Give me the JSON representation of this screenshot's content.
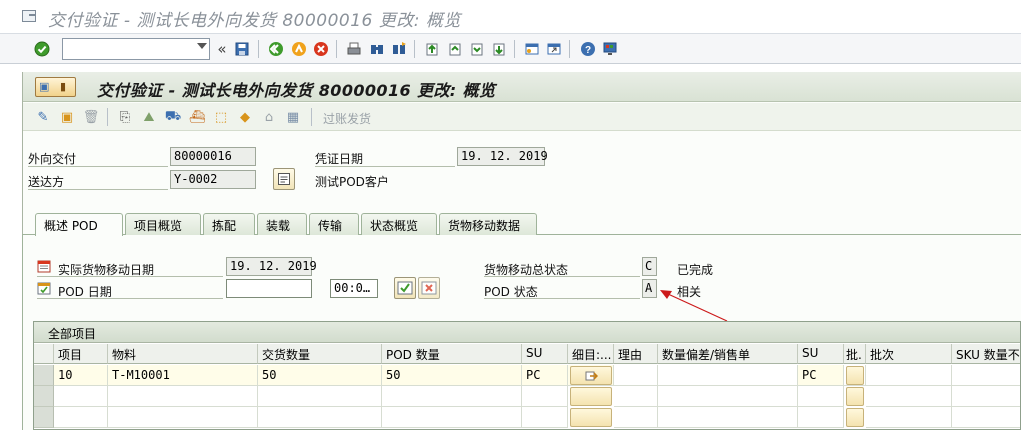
{
  "window": {
    "title": "交付验证 - 测试长电外向发货 80000016 更改: 概览"
  },
  "system_toolbar": {
    "command_field": "",
    "icons": [
      "enter-icon",
      "back-arrows-icon",
      "save-icon",
      "back-icon",
      "exit-icon",
      "cancel-icon",
      "print-icon",
      "find-icon",
      "find-next-icon",
      "first-page-icon",
      "prev-page-icon",
      "next-page-icon",
      "last-page-icon",
      "new-session-icon",
      "shortcut-icon",
      "help-icon",
      "customize-layout-icon"
    ]
  },
  "app": {
    "title": "交付验证 - 测试长电外向发货 80000016 更改: 概览",
    "toolbar": {
      "post_gi_label": "过账发货"
    },
    "header": {
      "outbound_delivery_label": "外向交付",
      "outbound_delivery_value": "80000016",
      "ship_to_label": "送达方",
      "ship_to_value": "Y-0002",
      "ship_to_name": "测试POD客户",
      "doc_date_label": "凭证日期",
      "doc_date_value": "19. 12. 2019"
    },
    "tabs": [
      {
        "label": "概述 POD",
        "active": true
      },
      {
        "label": "项目概览",
        "active": false
      },
      {
        "label": "拣配",
        "active": false
      },
      {
        "label": "装载",
        "active": false
      },
      {
        "label": "传输",
        "active": false
      },
      {
        "label": "状态概览",
        "active": false
      },
      {
        "label": "货物移动数据",
        "active": false
      }
    ],
    "overview": {
      "actual_gm_date_label": "实际货物移动日期",
      "actual_gm_date_value": "19. 12. 2019",
      "pod_date_label": "POD 日期",
      "pod_date_value": "",
      "pod_time_value": "00:0…",
      "gm_status_label": "货物移动总状态",
      "gm_status_value": "C",
      "gm_status_text": "已完成",
      "pod_status_label": "POD 状态",
      "pod_status_value": "A",
      "pod_status_text": "相关"
    },
    "items_grid": {
      "title": "全部项目",
      "columns": [
        "项目",
        "物料",
        "交货数量",
        "POD 数量",
        "SU",
        "细目:...",
        "理由",
        "数量偏差/销售单",
        "SU",
        "批.",
        "批次",
        "SKU 数量不同"
      ],
      "rows": [
        [
          "10",
          "T-M10001",
          "50",
          "50",
          "PC",
          "",
          "",
          "",
          "PC",
          "",
          "",
          ""
        ],
        [
          "",
          "",
          "",
          "",
          "",
          "",
          "",
          "",
          "",
          "",
          "",
          ""
        ],
        [
          "",
          "",
          "",
          "",
          "",
          "",
          "",
          "",
          "",
          "",
          "",
          ""
        ],
        [
          "",
          "",
          "",
          "",
          "",
          "",
          "",
          "",
          "",
          "",
          "",
          ""
        ]
      ]
    }
  },
  "colors": {
    "arrow": "#cc1a1a",
    "header_green": "#d9e2d4",
    "button_yellow": "#f4e3b0"
  }
}
